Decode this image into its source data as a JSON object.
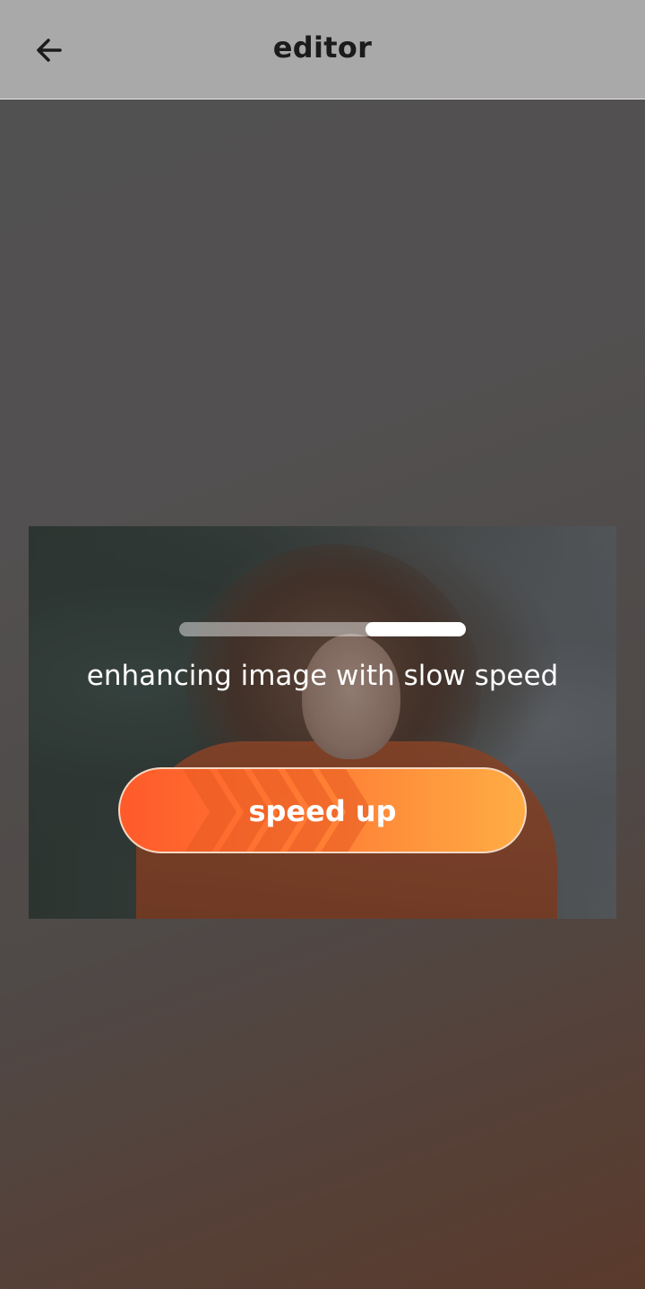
{
  "header": {
    "title": "editor",
    "back_icon": "arrow-left-icon"
  },
  "loader": {
    "progress_percent": 35,
    "status_text": "enhancing image with slow speed"
  },
  "speed_button": {
    "label": "speed up",
    "icon": "chevrons-right-icon",
    "colors": {
      "start": "#ff5a2a",
      "end": "#ffad45"
    }
  },
  "colors": {
    "topbar": "#a9a9a9",
    "title": "#1b1b1b"
  }
}
